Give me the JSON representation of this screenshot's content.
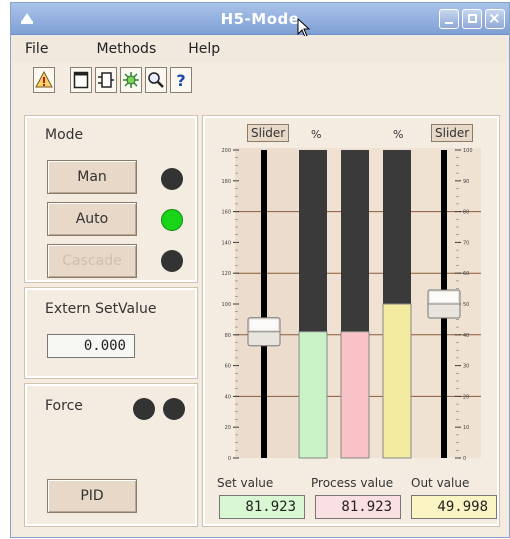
{
  "window": {
    "title": "H5-Mode"
  },
  "menu": [
    "File",
    "Methods",
    "Help"
  ],
  "toolbar": {
    "icons": [
      "warning-icon",
      "window-icon",
      "frame-icon",
      "network-icon",
      "zoom-icon",
      "help-icon"
    ],
    "help_label": "?"
  },
  "mode": {
    "label": "Mode",
    "buttons": {
      "man": "Man",
      "auto": "Auto",
      "cascade": "Cascade"
    },
    "active": "Auto"
  },
  "extern": {
    "label": "Extern SetValue",
    "value": "0.000"
  },
  "force": {
    "label": "Force"
  },
  "pid_label": "PID",
  "trend": {
    "slider_left": "Slider",
    "slider_right": "Slider",
    "pct_left": "%",
    "pct_right": "%",
    "left_scale": {
      "min": 0,
      "max": 200,
      "labels": [
        "200",
        "180",
        "160",
        "140",
        "120",
        "100",
        "80",
        "60",
        "40",
        "20",
        "0"
      ]
    },
    "right_scale": {
      "min": 0,
      "max": 100,
      "labels": [
        "100",
        "90",
        "80",
        "70",
        "60",
        "50",
        "40",
        "30",
        "20",
        "10",
        "0"
      ]
    },
    "set_value": 81.923,
    "process_value": 81.923,
    "out_value": 49.998,
    "set_value_fraction": 0.41,
    "process_value_fraction": 0.41,
    "out_value_fraction": 0.5,
    "set_slider_fraction": 0.41,
    "out_slider_fraction": 0.5
  },
  "values": {
    "set_label": "Set value",
    "process_label": "Process value",
    "out_label": "Out value",
    "set": "81.923",
    "process": "81.923",
    "out": "49.998"
  },
  "colors": {
    "set_bar": "#c9f2c6",
    "process_bar": "#f8c2c6",
    "out_bar": "#f3eba0",
    "bar_bg": "#3a3a3a",
    "gridline": "#8a5a3a"
  }
}
